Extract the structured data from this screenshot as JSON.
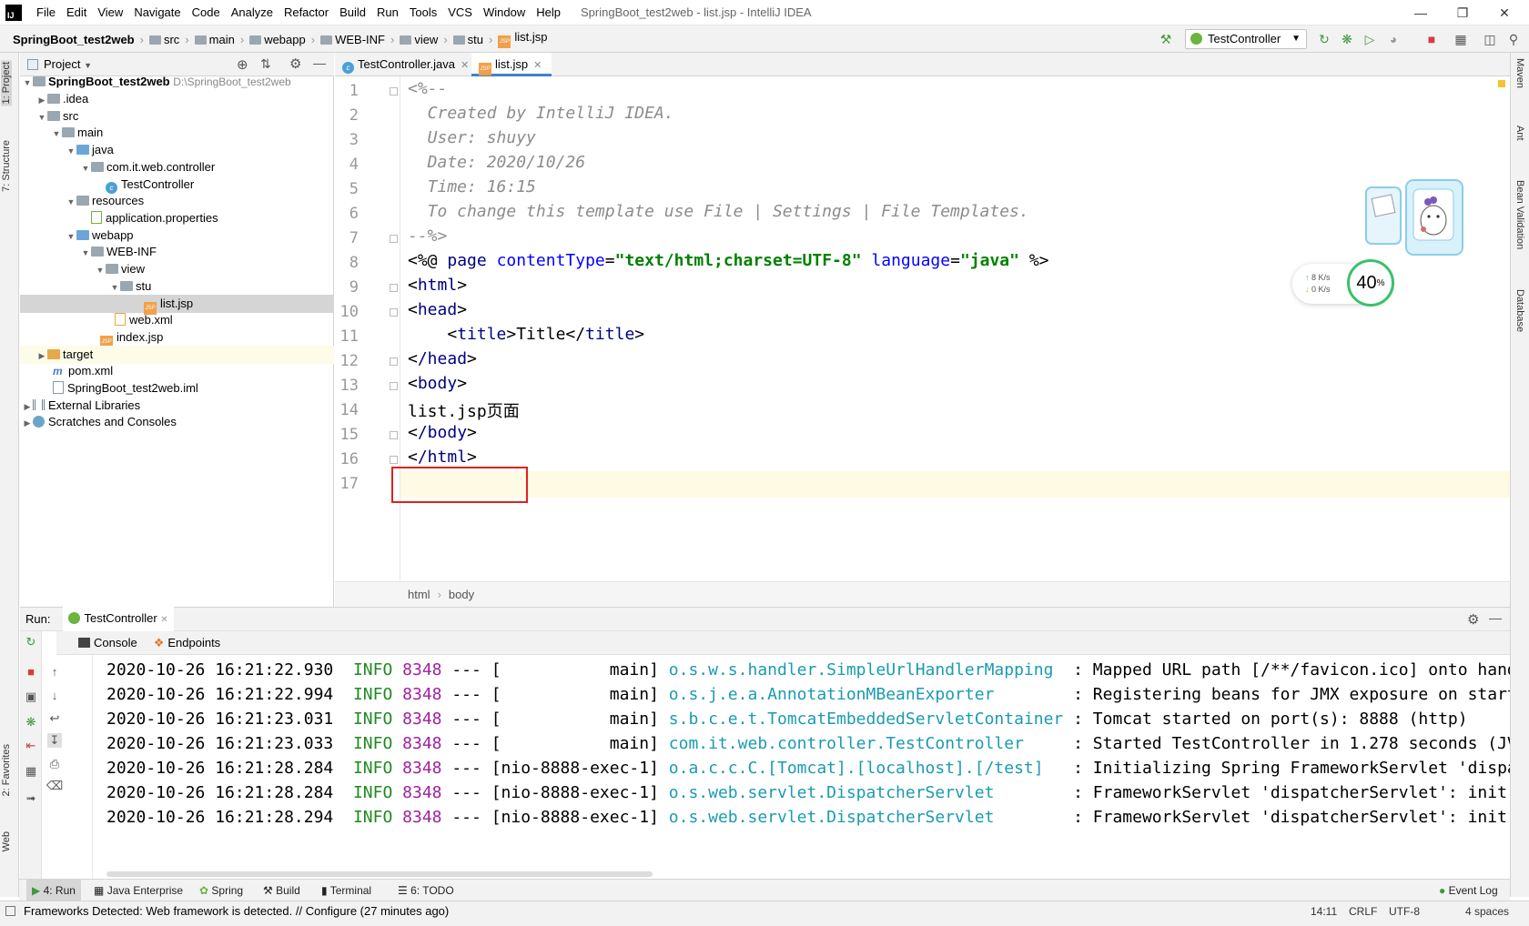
{
  "app": {
    "logo": "IJ",
    "window_title": "SpringBoot_test2web - list.jsp - IntelliJ IDEA",
    "menu": [
      "File",
      "Edit",
      "View",
      "Navigate",
      "Code",
      "Analyze",
      "Refactor",
      "Build",
      "Run",
      "Tools",
      "VCS",
      "Window",
      "Help"
    ],
    "accent": "#4083c9"
  },
  "navbar": {
    "breadcrumb": [
      "SpringBoot_test2web",
      "src",
      "main",
      "webapp",
      "WEB-INF",
      "view",
      "stu",
      "list.jsp"
    ],
    "run_config": "TestController"
  },
  "left_strip": {
    "project": "1: Project",
    "structure": "7: Structure",
    "favorites": "2: Favorites",
    "web": "Web"
  },
  "right_strip": {
    "maven": "Maven",
    "ant": "Ant",
    "bean": "Bean Validation",
    "database": "Database"
  },
  "project": {
    "title": "Project",
    "tree": [
      {
        "label": "SpringBoot_test2web",
        "extra": "D:\\SpringBoot_test2web"
      },
      {
        "label": ".idea"
      },
      {
        "label": "src"
      },
      {
        "label": "main"
      },
      {
        "label": "java"
      },
      {
        "label": "com.it.web.controller"
      },
      {
        "label": "TestController"
      },
      {
        "label": "resources"
      },
      {
        "label": "application.properties"
      },
      {
        "label": "webapp"
      },
      {
        "label": "WEB-INF"
      },
      {
        "label": "view"
      },
      {
        "label": "stu"
      },
      {
        "label": "list.jsp"
      },
      {
        "label": "web.xml"
      },
      {
        "label": "index.jsp"
      },
      {
        "label": "target"
      },
      {
        "label": "pom.xml"
      },
      {
        "label": "SpringBoot_test2web.iml"
      },
      {
        "label": "External Libraries"
      },
      {
        "label": "Scratches and Consoles"
      }
    ]
  },
  "editor": {
    "tabs": [
      {
        "label": "TestController.java"
      },
      {
        "label": "list.jsp"
      }
    ],
    "line_numbers": [
      "1",
      "2",
      "3",
      "4",
      "5",
      "6",
      "7",
      "8",
      "9",
      "10",
      "11",
      "12",
      "13",
      "14",
      "15",
      "16",
      "17"
    ],
    "comment_lines": [
      "<%--",
      "  Created by IntelliJ IDEA.",
      "  User: shuyy",
      "  Date: 2020/10/26",
      "  Time: 16:15",
      "  To change this template use File | Settings | File Templates.",
      "--%>"
    ],
    "directive": {
      "open": "<%@ ",
      "keyword": "page",
      "attr1": "contentType",
      "val1": "\"text/html;charset=UTF-8\"",
      "attr2": "language",
      "val2": "\"java\"",
      "close": " %>"
    },
    "html_open": "html",
    "head_open": "head",
    "title_tag": "title",
    "title_text": "Title",
    "head_close": "/head",
    "body_open": "body",
    "body_text": "list.jsp页面",
    "body_close": "/body",
    "html_close": "/html",
    "crumbs": [
      "html",
      "body"
    ]
  },
  "widget": {
    "up": "8",
    "down": "0",
    "unit": "K/s",
    "percent": "40",
    "percent_sign": "%"
  },
  "run": {
    "label": "Run:",
    "config": "TestController",
    "console_tab": "Console",
    "endpoints_tab": "Endpoints",
    "logs": [
      {
        "ts": "2020-10-26 16:21:22.930",
        "level": "INFO",
        "pid": "8348",
        "sep": "---",
        "thread": "[           main]",
        "cls": "o.s.w.s.handler.SimpleUrlHandlerMapping ",
        "msg": ": Mapped URL path [/**/favicon.ico] onto hand"
      },
      {
        "ts": "2020-10-26 16:21:22.994",
        "level": "INFO",
        "pid": "8348",
        "sep": "---",
        "thread": "[           main]",
        "cls": "o.s.j.e.a.AnnotationMBeanExporter       ",
        "msg": ": Registering beans for JMX exposure on start"
      },
      {
        "ts": "2020-10-26 16:21:23.031",
        "level": "INFO",
        "pid": "8348",
        "sep": "---",
        "thread": "[           main]",
        "cls": "s.b.c.e.t.TomcatEmbeddedServletContainer",
        "msg": ": Tomcat started on port(s): 8888 (http)"
      },
      {
        "ts": "2020-10-26 16:21:23.033",
        "level": "INFO",
        "pid": "8348",
        "sep": "---",
        "thread": "[           main]",
        "cls": "com.it.web.controller.TestController    ",
        "msg": ": Started TestController in 1.278 seconds (JV"
      },
      {
        "ts": "2020-10-26 16:21:28.284",
        "level": "INFO",
        "pid": "8348",
        "sep": "---",
        "thread": "[nio-8888-exec-1]",
        "cls": "o.a.c.c.C.[Tomcat].[localhost].[/test]  ",
        "msg": ": Initializing Spring FrameworkServlet 'dispa"
      },
      {
        "ts": "2020-10-26 16:21:28.284",
        "level": "INFO",
        "pid": "8348",
        "sep": "---",
        "thread": "[nio-8888-exec-1]",
        "cls": "o.s.web.servlet.DispatcherServlet       ",
        "msg": ": FrameworkServlet 'dispatcherServlet': init"
      },
      {
        "ts": "2020-10-26 16:21:28.294",
        "level": "INFO",
        "pid": "8348",
        "sep": "---",
        "thread": "[nio-8888-exec-1]",
        "cls": "o.s.web.servlet.DispatcherServlet       ",
        "msg": ": FrameworkServlet 'dispatcherServlet': init"
      }
    ]
  },
  "bottom_tabs": [
    "4: Run",
    "Java Enterprise",
    "Spring",
    "Build",
    "Terminal",
    "6: TODO",
    "Event Log"
  ],
  "status": {
    "message": "Frameworks Detected: Web framework is detected. // Configure (27 minutes ago)",
    "position": "14:11",
    "line_sep": "CRLF",
    "encoding": "UTF-8",
    "indent": "4 spaces"
  }
}
